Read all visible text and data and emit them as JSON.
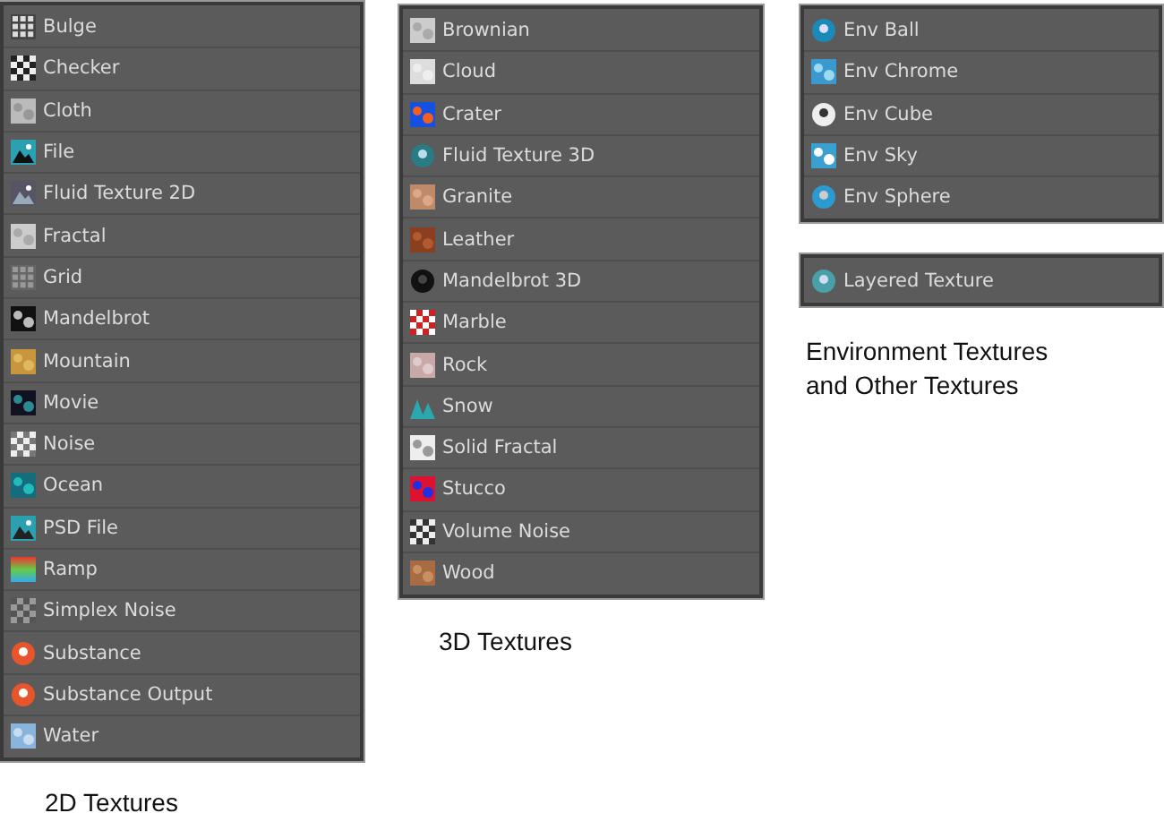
{
  "groups": [
    {
      "panels": [
        {
          "items": [
            "Bulge",
            "Checker",
            "Cloth",
            "File",
            "Fluid Texture 2D",
            "Fractal",
            "Grid",
            "Mandelbrot",
            "Mountain",
            "Movie",
            "Noise",
            "Ocean",
            "PSD File",
            "Ramp",
            "Simplex Noise",
            "Substance",
            "Substance Output",
            "Water"
          ]
        }
      ],
      "caption": "2D Textures"
    },
    {
      "panels": [
        {
          "items": [
            "Brownian",
            "Cloud",
            "Crater",
            "Fluid Texture 3D",
            "Granite",
            "Leather",
            "Mandelbrot 3D",
            "Marble",
            "Rock",
            "Snow",
            "Solid Fractal",
            "Stucco",
            "Volume Noise",
            "Wood"
          ]
        }
      ],
      "caption": "3D Textures"
    },
    {
      "panels": [
        {
          "items": [
            "Env Ball",
            "Env Chrome",
            "Env Cube",
            "Env Sky",
            "Env Sphere"
          ]
        },
        {
          "items": [
            "Layered Texture"
          ]
        }
      ],
      "caption": "Environment Textures and Other Textures"
    }
  ]
}
